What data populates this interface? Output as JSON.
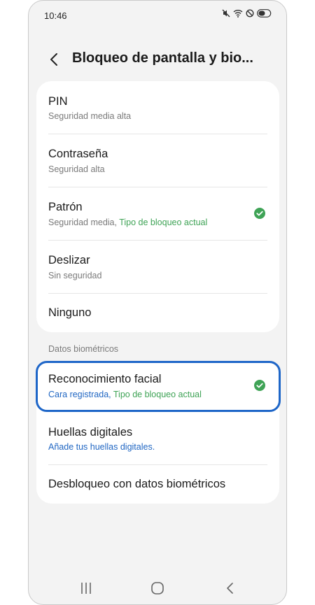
{
  "status_bar": {
    "time": "10:46",
    "icons": [
      "mute-icon",
      "wifi-icon",
      "do-not-disturb-icon",
      "battery-icon"
    ]
  },
  "header": {
    "back_icon": "chevron-left-icon",
    "title": "Bloqueo de pantalla y bio..."
  },
  "lock_types": [
    {
      "title": "PIN",
      "subtitle": "Seguridad media alta"
    },
    {
      "title": "Contraseña",
      "subtitle": "Seguridad alta"
    },
    {
      "title": "Patrón",
      "subtitle": "Seguridad media,",
      "subtitle_status": "Tipo de bloqueo actual",
      "selected": true
    },
    {
      "title": "Deslizar",
      "subtitle": "Sin seguridad"
    },
    {
      "title": "Ninguno"
    }
  ],
  "biometrics": {
    "section_label": "Datos biométricos",
    "items": [
      {
        "title": "Reconocimiento facial",
        "subtitle": "Cara registrada,",
        "subtitle_status": "Tipo de bloqueo actual",
        "selected": true
      },
      {
        "title": "Huellas digitales",
        "subtitle": "Añade tus huellas digitales."
      },
      {
        "title": "Desbloqueo con datos biométricos"
      }
    ]
  },
  "nav_bar": {
    "icons": [
      "recents-icon",
      "home-icon",
      "back-icon"
    ]
  },
  "colors": {
    "accent_blue": "#1e66c8",
    "status_green": "#3fa356",
    "link_blue": "#2167c3",
    "background": "#f3f3f3",
    "card": "#ffffff"
  }
}
